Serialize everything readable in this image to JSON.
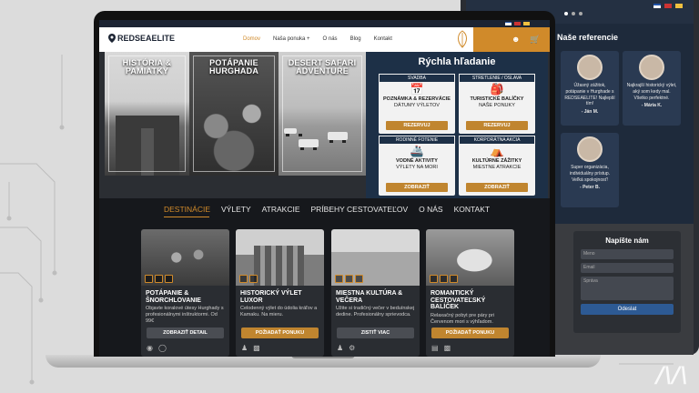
{
  "brand": {
    "logo": "REDSEAELITE"
  },
  "nav": {
    "items": [
      {
        "label": "Domov",
        "active": true
      },
      {
        "label": "Naša ponuka +",
        "active": false
      },
      {
        "label": "O nás",
        "active": false
      },
      {
        "label": "Blog",
        "active": false
      },
      {
        "label": "Kontakt",
        "active": false
      }
    ]
  },
  "hero": {
    "panels": [
      {
        "title": "HISTÓRIA & PAMIATKY"
      },
      {
        "title": "POTÁPANIE HURGHADA"
      },
      {
        "title": "DESERT SAFARI ADVENTURE"
      }
    ]
  },
  "quick_search": {
    "title": "Rýchla hľadanie",
    "boxes": [
      {
        "category": "SVADBA",
        "icon": "calendar-icon",
        "line1": "POZNÁMKA & REZERVÁCIE",
        "line2": "DÁTUMY VÝLETOV",
        "button": "REZERVUJ"
      },
      {
        "category": "STRETLENIE / OSLAVA",
        "icon": "backpack-icon",
        "line1": "TURISTICKÉ BALÍČKY",
        "line2": "NAŠE PONUKY",
        "button": "REZERVUJ"
      },
      {
        "category": "RODINNÉ FOTENIE",
        "icon": "ship-icon",
        "line1": "VODNÉ AKTIVITY",
        "line2": "VÝLETY NA MORI",
        "button": "ZOBRAZIŤ"
      },
      {
        "category": "KORPORÁTNA AKCIA",
        "icon": "tent-icon",
        "line1": "KULTÚRNE ZÁŽITKY",
        "line2": "MIESTNE ATRAKCIE",
        "button": "ZOBRAZIŤ"
      }
    ]
  },
  "category_tabs": [
    {
      "label": "DESTINÁCIE",
      "active": true
    },
    {
      "label": "VÝLETY",
      "active": false
    },
    {
      "label": "ATRAKCIE",
      "active": false
    },
    {
      "label": "PRÍBEHY CESTOVATEĽOV",
      "active": false
    },
    {
      "label": "O NÁS",
      "active": false
    },
    {
      "label": "KONTAKT",
      "active": false
    }
  ],
  "cards": [
    {
      "title": "POTÁPANIE & ŠNORCHLOVANIE",
      "desc": "Objavte koralové útesy Hurghady s profesionálnymi inštruktormi. Od 99€",
      "button": "ZOBRAZIŤ DETAIL",
      "button_color": "#4a4d53"
    },
    {
      "title": "HISTORICKÝ VÝLET LUXOR",
      "desc": "Celodenný výlet do údolia kráľov a Kamaku. Na mieru.",
      "button": "POŽIADAŤ PONUKU",
      "button_color": "#c0852f"
    },
    {
      "title": "MIESTNA KULTÚRA & VEČERA",
      "desc": "Užite si tradičný večer v beduínskej dedine. Profesionálny sprievodca.",
      "button": "ZISTIŤ VIAC",
      "button_color": "#4a4d53"
    },
    {
      "title": "ROMANTICKÝ CESTOVATEĽSKÝ BALÍČEK",
      "desc": "Relaxačný pobyt pre páry pri Červenom mori s výhľadom.",
      "button": "POŽIADAŤ PONUKU",
      "button_color": "#c0852f"
    }
  ],
  "phone": {
    "references_title": "Naše referencie",
    "references": [
      {
        "quote": "Úžasný zážitok, potápanie v Hurghade s REDSEAELITE! Najlepší tím!",
        "author": "- Ján M."
      },
      {
        "quote": "Najkrajší historický výlet, aký som kedy mal. Všetko perfektné.",
        "author": "- Mária K."
      },
      {
        "quote": "Super organizácia, individuálny prístup. Veľká spokojnosť!",
        "author": "- Peter B."
      }
    ],
    "contact": {
      "title": "Napíšte nám",
      "name_placeholder": "Meno",
      "email_placeholder": "Email",
      "message_placeholder": "Správa",
      "send": "Odeslat"
    }
  },
  "colors": {
    "accent": "#d08a2a",
    "navy": "#1d3047",
    "dark": "#16181c"
  }
}
